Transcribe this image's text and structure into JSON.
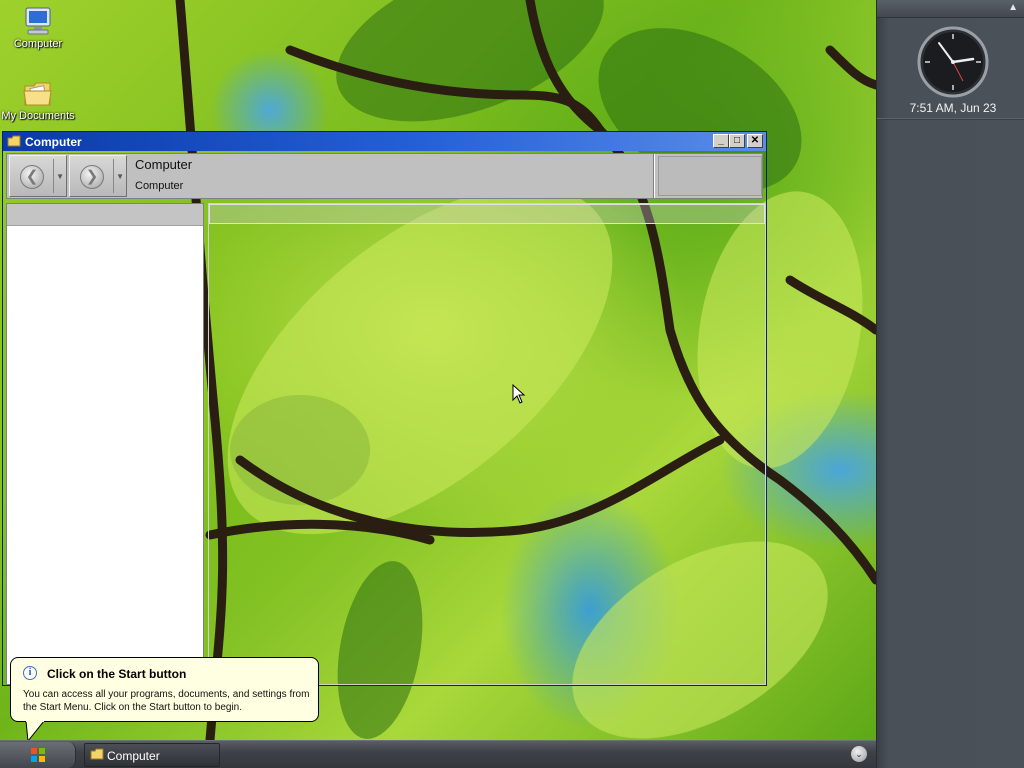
{
  "desktop": {
    "icons": [
      {
        "label": "Computer",
        "icon": "computer-icon"
      },
      {
        "label": "My Documents",
        "icon": "documents-folder-icon"
      }
    ]
  },
  "sidebar": {
    "clock_icon": "analog-clock-icon",
    "time_text": "7:51 AM, Jun 23"
  },
  "window": {
    "title": "Computer",
    "address_main": "Computer",
    "address_sub": "Computer",
    "buttons": {
      "minimize": "_",
      "maximize": "□",
      "close": "✕"
    }
  },
  "balloon": {
    "title": "Click on the Start button",
    "body": "You can access all your programs, documents, and settings from the Start Menu. Click on the Start button to begin.",
    "icon": "info-icon"
  },
  "taskbar": {
    "task_label": "Computer",
    "start_icon": "windows-flag-icon",
    "tray_icon": "chevron-down-icon"
  },
  "colors": {
    "titlebar": "#0a3aa8",
    "sidebar": "#4a5058",
    "taskbar": "#3e4248",
    "balloon": "#ffffe1"
  }
}
